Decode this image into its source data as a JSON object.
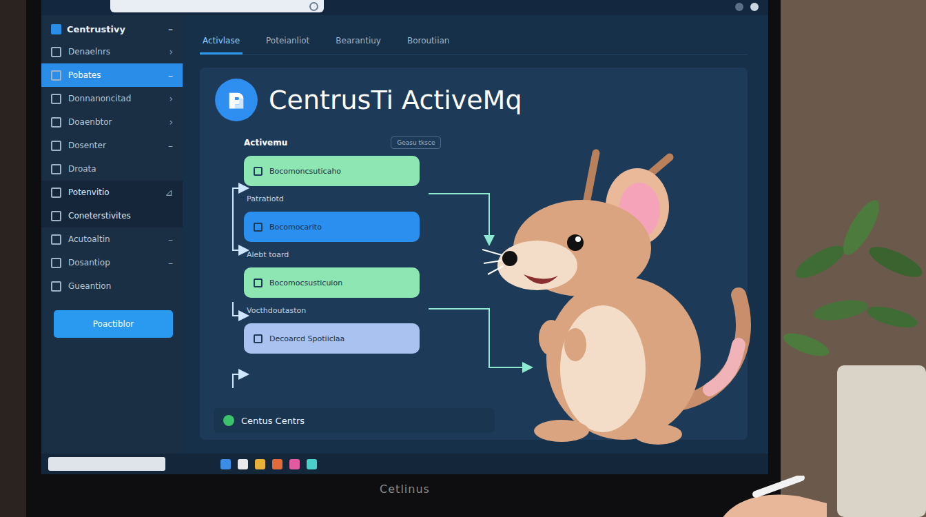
{
  "sidebar": {
    "title": "Centrustivy",
    "title_marker": "–",
    "items": [
      {
        "label": "Denaelnrs",
        "marker": "›",
        "selected": false,
        "highlighted": false
      },
      {
        "label": "Pobates",
        "marker": "–",
        "selected": true,
        "highlighted": false
      },
      {
        "label": "Donnanoncitad",
        "marker": "›",
        "selected": false,
        "highlighted": false
      },
      {
        "label": "Doaenbtor",
        "marker": "›",
        "selected": false,
        "highlighted": false
      },
      {
        "label": "Dosenter",
        "marker": "–",
        "selected": false,
        "highlighted": false
      },
      {
        "label": "Droata",
        "marker": "",
        "selected": false,
        "highlighted": false
      },
      {
        "label": "Potenvitio",
        "marker": "⊿",
        "selected": false,
        "highlighted": true
      },
      {
        "label": "Coneterstivites",
        "marker": "",
        "selected": false,
        "highlighted": true
      },
      {
        "label": "Acutoaltin",
        "marker": "–",
        "selected": false,
        "highlighted": false
      },
      {
        "label": "Dosantiop",
        "marker": "–",
        "selected": false,
        "highlighted": false
      },
      {
        "label": "Gueantion",
        "marker": "",
        "selected": false,
        "highlighted": false
      }
    ],
    "button": "Poactiblor"
  },
  "tabs": [
    {
      "label": "Activlase",
      "selected": true
    },
    {
      "label": "Poteianliot",
      "selected": false
    },
    {
      "label": "Bearantiuy",
      "selected": false
    },
    {
      "label": "Boroutiian",
      "selected": false
    }
  ],
  "app": {
    "title": "CentrusTi ActiveMq"
  },
  "flow": {
    "title": "Activemu",
    "badge": "Geasu tksce",
    "steps": [
      {
        "text": "Bocomoncsuticaho",
        "color": "#8ee6b2"
      },
      {
        "caption": "Patratiotd",
        "text": "Bocomocarito",
        "color": "#2b8ff0"
      },
      {
        "caption": "Alebt toard",
        "text": "Bocomocsusticuion",
        "color": "#8ee6b2"
      },
      {
        "caption": "Vocthdoutaston",
        "text": "Decoarcd Spotiiclaa",
        "color": "#a9c2f0"
      }
    ]
  },
  "footer": {
    "text": "Centus Centrs"
  },
  "taskbar": {
    "apps": [
      {
        "color": "#3a8ee6"
      },
      {
        "color": "#e9e9e9"
      },
      {
        "color": "#e8b23a"
      },
      {
        "color": "#e36a3a"
      },
      {
        "color": "#e35aa0"
      },
      {
        "color": "#4ad0c8"
      }
    ]
  },
  "monitor": {
    "brand": "Cetlinus"
  }
}
